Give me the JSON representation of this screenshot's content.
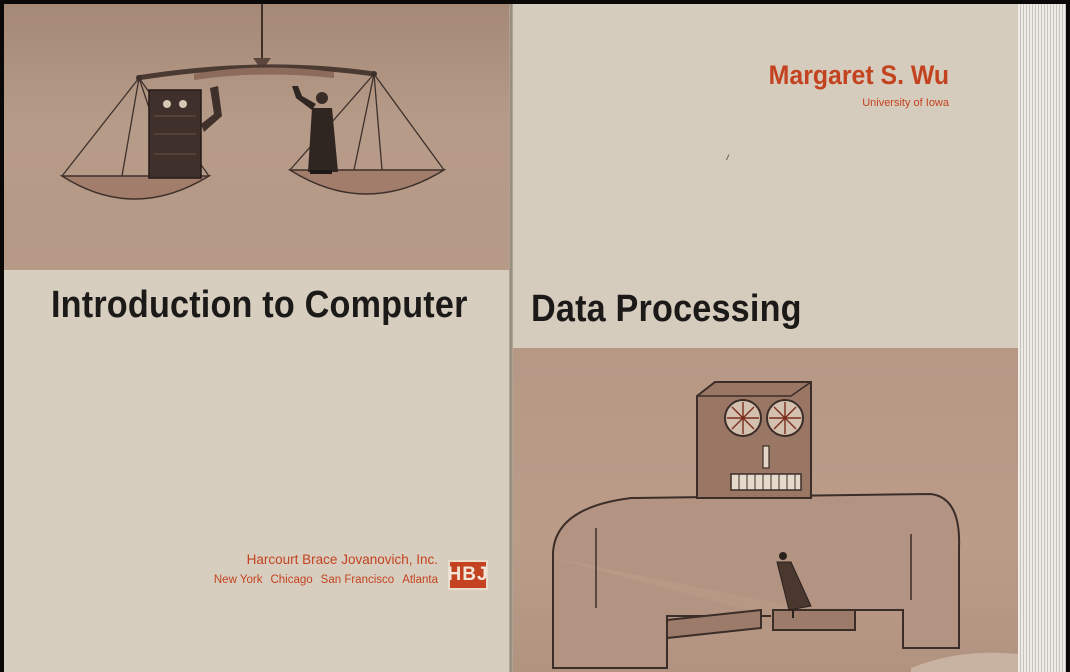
{
  "book": {
    "title_left": "Introduction to Computer",
    "title_right": "Data Processing",
    "author": "Margaret S. Wu",
    "affiliation": "University of Iowa",
    "publisher": {
      "name": "Harcourt Brace Jovanovich, Inc.",
      "cities": [
        "New York",
        "Chicago",
        "San Francisco",
        "Atlanta"
      ],
      "logo_text": "HBJ"
    }
  },
  "colors": {
    "accent": "#c3421f",
    "title_text": "#1c1a19",
    "paper": "#d8cebf",
    "illustration_wash": "#b69987"
  },
  "icons": [
    "balance-scale-illustration",
    "computer-on-scale",
    "man-on-scale",
    "robot-computer-illustration",
    "small-man-in-robot-hands",
    "publisher-logo"
  ]
}
